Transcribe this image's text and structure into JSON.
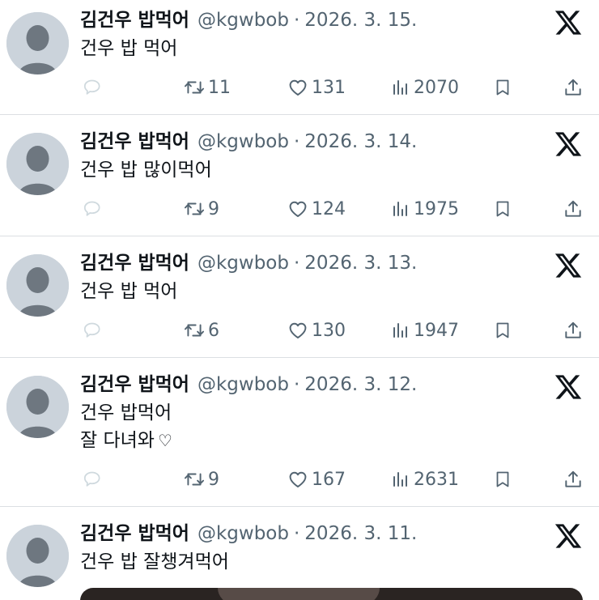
{
  "tweets": [
    {
      "name": "김건우 밥먹어",
      "handle": "@kgwbob",
      "sep": "·",
      "date": "2026. 3. 15.",
      "lines": [
        "건우 밥 먹어"
      ],
      "retweets": "11",
      "likes": "131",
      "views": "2070"
    },
    {
      "name": "김건우 밥먹어",
      "handle": "@kgwbob",
      "sep": "·",
      "date": "2026. 3. 14.",
      "lines": [
        "건우 밥 많이먹어"
      ],
      "retweets": "9",
      "likes": "124",
      "views": "1975"
    },
    {
      "name": "김건우 밥먹어",
      "handle": "@kgwbob",
      "sep": "·",
      "date": "2026. 3. 13.",
      "lines": [
        "건우 밥 먹어"
      ],
      "retweets": "6",
      "likes": "130",
      "views": "1947"
    },
    {
      "name": "김건우 밥먹어",
      "handle": "@kgwbob",
      "sep": "·",
      "date": "2026. 3. 12.",
      "lines": [
        "건우 밥먹어",
        "잘 다녀와"
      ],
      "heart_glyph": "♡",
      "retweets": "9",
      "likes": "167",
      "views": "2631"
    },
    {
      "name": "김건우 밥먹어",
      "handle": "@kgwbob",
      "sep": "·",
      "date": "2026. 3. 11.",
      "lines": [
        "건우 밥 잘챙겨먹어"
      ]
    }
  ],
  "icons": {
    "reply": "reply-icon",
    "retweet": "retweet-icon",
    "like": "heart-icon",
    "views": "views-icon",
    "bookmark": "bookmark-icon",
    "share": "share-icon",
    "brand": "x-logo-icon",
    "avatar": "default-avatar-icon"
  },
  "colors": {
    "text": "#0f1419",
    "secondary": "#536471",
    "divider": "#dcdfe3",
    "avatar_bg": "#cbd3db",
    "avatar_fg": "#6e7780"
  }
}
